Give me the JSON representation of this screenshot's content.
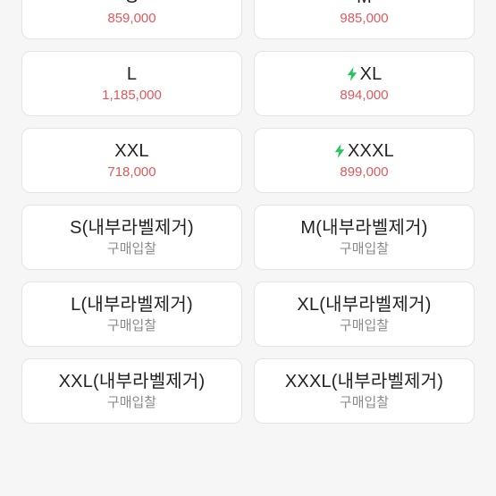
{
  "colors": {
    "background": "#f6f6f7",
    "card": "#ffffff",
    "price": "#e1585b",
    "bid_label": "#8a8a8e",
    "bolt": "#22c55e"
  },
  "cards": [
    {
      "size": "S",
      "price": "859,000",
      "express": false,
      "type": "price"
    },
    {
      "size": "M",
      "price": "985,000",
      "express": false,
      "type": "price"
    },
    {
      "size": "L",
      "price": "1,185,000",
      "express": false,
      "type": "price"
    },
    {
      "size": "XL",
      "price": "894,000",
      "express": true,
      "type": "price"
    },
    {
      "size": "XXL",
      "price": "718,000",
      "express": false,
      "type": "price"
    },
    {
      "size": "XXXL",
      "price": "899,000",
      "express": true,
      "type": "price"
    },
    {
      "size": "S(내부라벨제거)",
      "price": "구매입찰",
      "express": false,
      "type": "bid"
    },
    {
      "size": "M(내부라벨제거)",
      "price": "구매입찰",
      "express": false,
      "type": "bid"
    },
    {
      "size": "L(내부라벨제거)",
      "price": "구매입찰",
      "express": false,
      "type": "bid"
    },
    {
      "size": "XL(내부라벨제거)",
      "price": "구매입찰",
      "express": false,
      "type": "bid"
    },
    {
      "size": "XXL(내부라벨제거)",
      "price": "구매입찰",
      "express": false,
      "type": "bid"
    },
    {
      "size": "XXXL(내부라벨제거)",
      "price": "구매입찰",
      "express": false,
      "type": "bid"
    }
  ],
  "icons": {
    "express": "lightning-bolt-icon"
  }
}
